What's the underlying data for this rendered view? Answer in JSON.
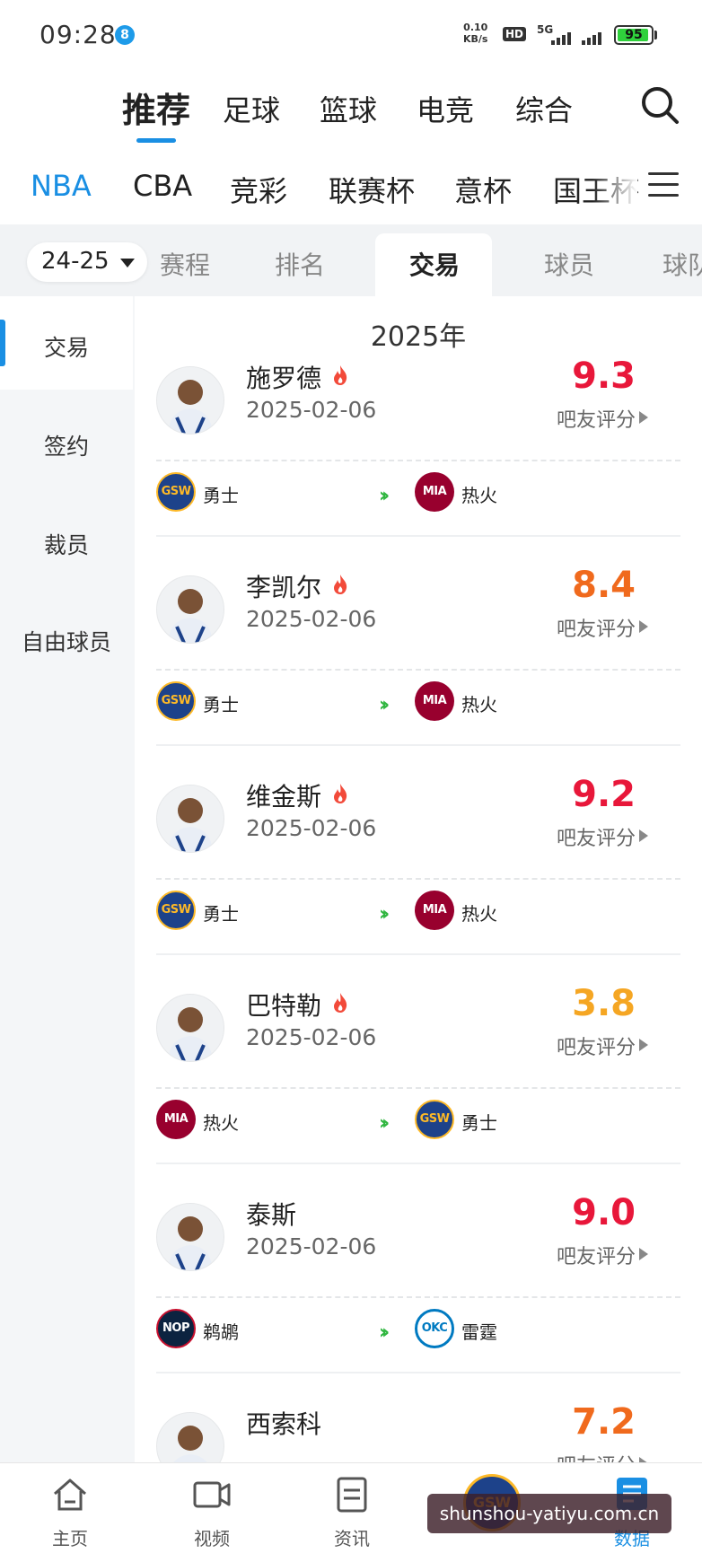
{
  "status_bar": {
    "time": "09:28",
    "notification_badge": "8",
    "net_speed_value": "0.10",
    "net_speed_unit": "KB/s",
    "hd_label": "HD",
    "network_label": "5G",
    "battery_level": 95,
    "battery_text": "95"
  },
  "top_nav": {
    "tabs": [
      "推荐",
      "足球",
      "篮球",
      "电竞",
      "综合"
    ],
    "active_index": 0,
    "search_icon": "search-icon"
  },
  "leagues": {
    "items": [
      "NBA",
      "CBA",
      "竞彩",
      "联赛杯",
      "意杯",
      "国王杯"
    ],
    "active_index": 0,
    "menu_icon": "menu-icon"
  },
  "sub_tabs": {
    "season": "24-25",
    "items": [
      "赛程",
      "排名",
      "交易",
      "球员",
      "球队"
    ],
    "active": "交易"
  },
  "side_menu": {
    "items": [
      "交易",
      "签约",
      "裁员",
      "自由球员"
    ],
    "active_index": 0
  },
  "main": {
    "year": "2025年",
    "score_label": "吧友评分",
    "trades": [
      {
        "player": "施罗德",
        "date": "2025-02-06",
        "score": "9.3",
        "score_color": "#e8173a",
        "from_team": "勇士",
        "from_code": "GSW",
        "to_team": "热火",
        "to_code": "MIA",
        "hot": true
      },
      {
        "player": "李凯尔",
        "date": "2025-02-06",
        "score": "8.4",
        "score_color": "#f06a1d",
        "from_team": "勇士",
        "from_code": "GSW",
        "to_team": "热火",
        "to_code": "MIA",
        "hot": true
      },
      {
        "player": "维金斯",
        "date": "2025-02-06",
        "score": "9.2",
        "score_color": "#e8173a",
        "from_team": "勇士",
        "from_code": "GSW",
        "to_team": "热火",
        "to_code": "MIA",
        "hot": true
      },
      {
        "player": "巴特勒",
        "date": "2025-02-06",
        "score": "3.8",
        "score_color": "#f5a623",
        "from_team": "热火",
        "from_code": "MIA",
        "to_team": "勇士",
        "to_code": "GSW",
        "hot": true
      },
      {
        "player": "泰斯",
        "date": "2025-02-06",
        "score": "9.0",
        "score_color": "#e8173a",
        "from_team": "鹈鹕",
        "from_code": "NOP",
        "to_team": "雷霆",
        "to_code": "OKC",
        "hot": false
      },
      {
        "player": "西索科",
        "date": "",
        "score": "7.2",
        "score_color": "#f06a1d",
        "from_team": "",
        "from_code": "",
        "to_team": "",
        "to_code": "",
        "hot": false
      }
    ]
  },
  "bottom_nav": {
    "items": [
      {
        "label": "主页",
        "icon": "home-icon"
      },
      {
        "label": "视频",
        "icon": "video-icon"
      },
      {
        "label": "资讯",
        "icon": "news-icon"
      },
      {
        "label": "",
        "icon": "team-logo"
      },
      {
        "label": "数据",
        "icon": "data-icon"
      }
    ],
    "center_logo_text": "GSW",
    "active_index": 4
  },
  "watermark": "shunshou-yatiyu.com.cn"
}
